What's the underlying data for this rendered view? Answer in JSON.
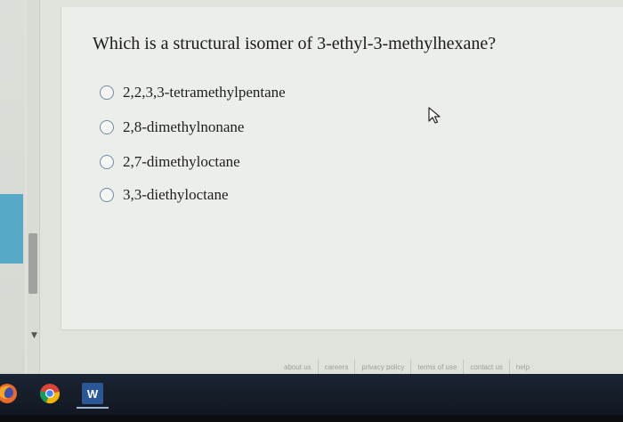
{
  "question": {
    "text": "Which is a structural isomer of 3-ethyl-3-methylhexane?"
  },
  "options": [
    {
      "label": "2,2,3,3-tetramethylpentane"
    },
    {
      "label": "2,8-dimethylnonane"
    },
    {
      "label": "2,7-dimethyloctane"
    },
    {
      "label": "3,3-diethyloctane"
    }
  ],
  "footer": {
    "links": [
      "about us",
      "careers",
      "privacy policy",
      "terms of use",
      "contact us",
      "help"
    ]
  },
  "taskbar": {
    "apps": [
      {
        "icon": "firefox-icon"
      },
      {
        "icon": "chrome-icon"
      },
      {
        "icon": "word-icon",
        "text": "W"
      }
    ]
  },
  "colors": {
    "accent": "#57a9c8",
    "radio_border": "#6e8aa6",
    "taskbar": "#151d29"
  }
}
